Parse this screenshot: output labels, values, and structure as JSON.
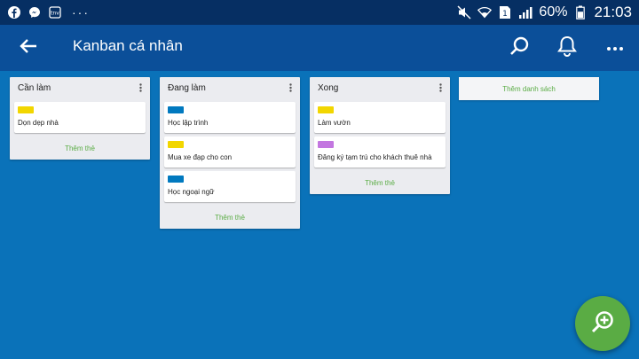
{
  "status_bar": {
    "left_icons": [
      "facebook-icon",
      "messenger-icon",
      "tinder-icon"
    ],
    "more_dots": "···",
    "right_icons": [
      "mute-icon",
      "wifi-icon",
      "sim-icon",
      "signal-icon"
    ],
    "sim_number": "1",
    "battery": "60%",
    "time": "21:03"
  },
  "app_bar": {
    "title": "Kanban cá nhân",
    "actions": [
      "search-icon",
      "bell-icon",
      "more-vertical-icon"
    ],
    "more_label": "···"
  },
  "colors": {
    "status_bar_bg": "#062f63",
    "app_bar_bg": "#0b4f99",
    "board_bg": "#0a72b9",
    "accent_green": "#5aac44",
    "label_yellow": "#f2d600",
    "label_blue": "#0079bf",
    "label_purple": "#c377e0"
  },
  "board": {
    "lists": [
      {
        "title": "Cần làm",
        "cards": [
          {
            "label_color": "#f2d600",
            "title": "Dọn dẹp nhà"
          }
        ],
        "add_card_label": "Thêm thẻ"
      },
      {
        "title": "Đang làm",
        "cards": [
          {
            "label_color": "#0079bf",
            "title": "Học lập trình"
          },
          {
            "label_color": "#f2d600",
            "title": "Mua xe đạp cho con"
          },
          {
            "label_color": "#0079bf",
            "title": "Học ngoại ngữ"
          }
        ],
        "add_card_label": "Thêm thẻ"
      },
      {
        "title": "Xong",
        "cards": [
          {
            "label_color": "#f2d600",
            "title": "Làm vườn"
          },
          {
            "label_color": "#c377e0",
            "title": "Đăng ký tạm trú cho khách thuê nhà"
          }
        ],
        "add_card_label": "Thêm thẻ"
      }
    ],
    "add_list_label": "Thêm danh sách"
  },
  "fab": {
    "icon": "zoom-in-icon"
  }
}
